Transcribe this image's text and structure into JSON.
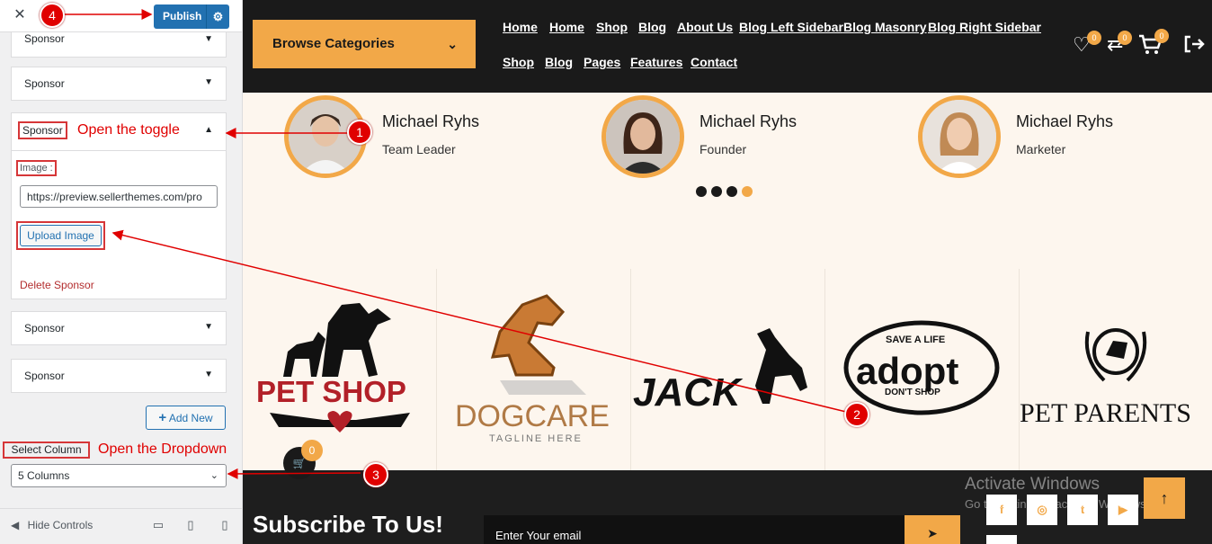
{
  "customizer": {
    "close_label": "✕",
    "publish_label": "Publish",
    "sections": [
      "Sponsor",
      "Sponsor",
      "Sponsor",
      "Sponsor"
    ],
    "open_section": {
      "title": "Sponsor",
      "image_label": "Image :",
      "image_url": "https://preview.sellerthemes.com/pro",
      "upload_label": "Upload Image",
      "delete_label": "Delete Sponsor"
    },
    "add_new_label": "Add New",
    "select_column_label": "Select Column",
    "select_value": "5 Columns",
    "hide_controls_label": "Hide Controls"
  },
  "annotations": {
    "step1_text": "Open the toggle",
    "step3_text": "Open the Dropdown",
    "badges": [
      "1",
      "2",
      "3",
      "4"
    ],
    "color": "#e00000"
  },
  "site": {
    "browse_label": "Browse Categories",
    "nav_row1": [
      "Home",
      "Home",
      "Shop",
      "Blog",
      "About Us",
      "Blog Left Sidebar",
      "Blog Masonry",
      "Blog Right Sidebar"
    ],
    "nav_row2": [
      "Shop",
      "Blog",
      "Pages",
      "Features",
      "Contact"
    ],
    "wishlist_count": "0",
    "compare_count": "0",
    "cart_count": "0",
    "floating_cart_count": "0",
    "accent": "#f2a848",
    "team": [
      {
        "name": "Michael Ryhs",
        "role": "Team Leader"
      },
      {
        "name": "Michael Ryhs",
        "role": "Founder"
      },
      {
        "name": "Michael Ryhs",
        "role": "Marketer"
      }
    ],
    "brands": [
      {
        "name": "PET SHOP"
      },
      {
        "name": "DOGCARE",
        "tagline": "TAGLINE HERE"
      },
      {
        "name": "JACK"
      },
      {
        "name": "adopt",
        "top": "SAVE A LIFE",
        "bottom": "DON'T SHOP"
      },
      {
        "name": "PET PARENTS"
      }
    ],
    "subscribe_title": "Subscribe To Us!",
    "email_placeholder": "Enter Your email",
    "watermark_title": "Activate Windows",
    "watermark_sub": "Go to Settings to activate Windows."
  }
}
